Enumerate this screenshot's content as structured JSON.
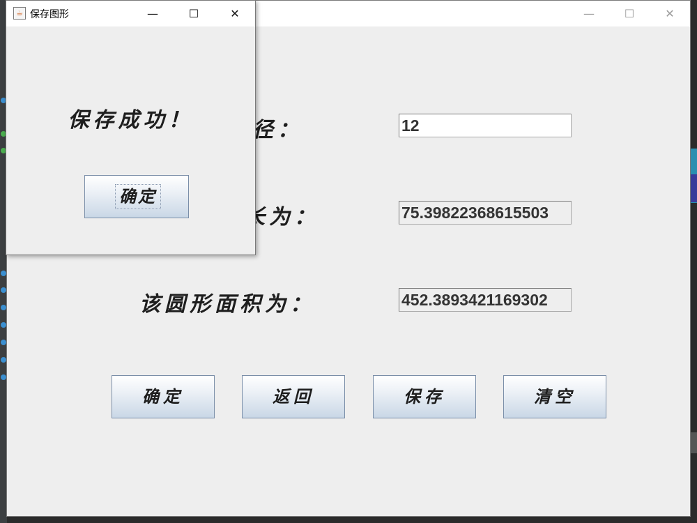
{
  "main_window": {
    "controls": {
      "minimize": "—",
      "maximize": "☐",
      "close": "✕"
    },
    "labels": {
      "radius_partial": "径：",
      "circumference_partial": "长为：",
      "area": "该圆形面积为："
    },
    "fields": {
      "radius": "12",
      "circumference": "75.39822368615503",
      "area": "452.3893421169302"
    },
    "buttons": {
      "confirm": "确定",
      "back": "返回",
      "save": "保存",
      "clear": "清空"
    }
  },
  "dialog": {
    "title": "保存图形",
    "message": "保存成功！",
    "ok_button": "确定",
    "controls": {
      "minimize": "—",
      "maximize": "☐",
      "close": "✕"
    }
  },
  "colors": {
    "window_bg": "#eeeeee",
    "button_gradient_end": "#c9d7e6",
    "button_border": "#7a8ea8"
  }
}
